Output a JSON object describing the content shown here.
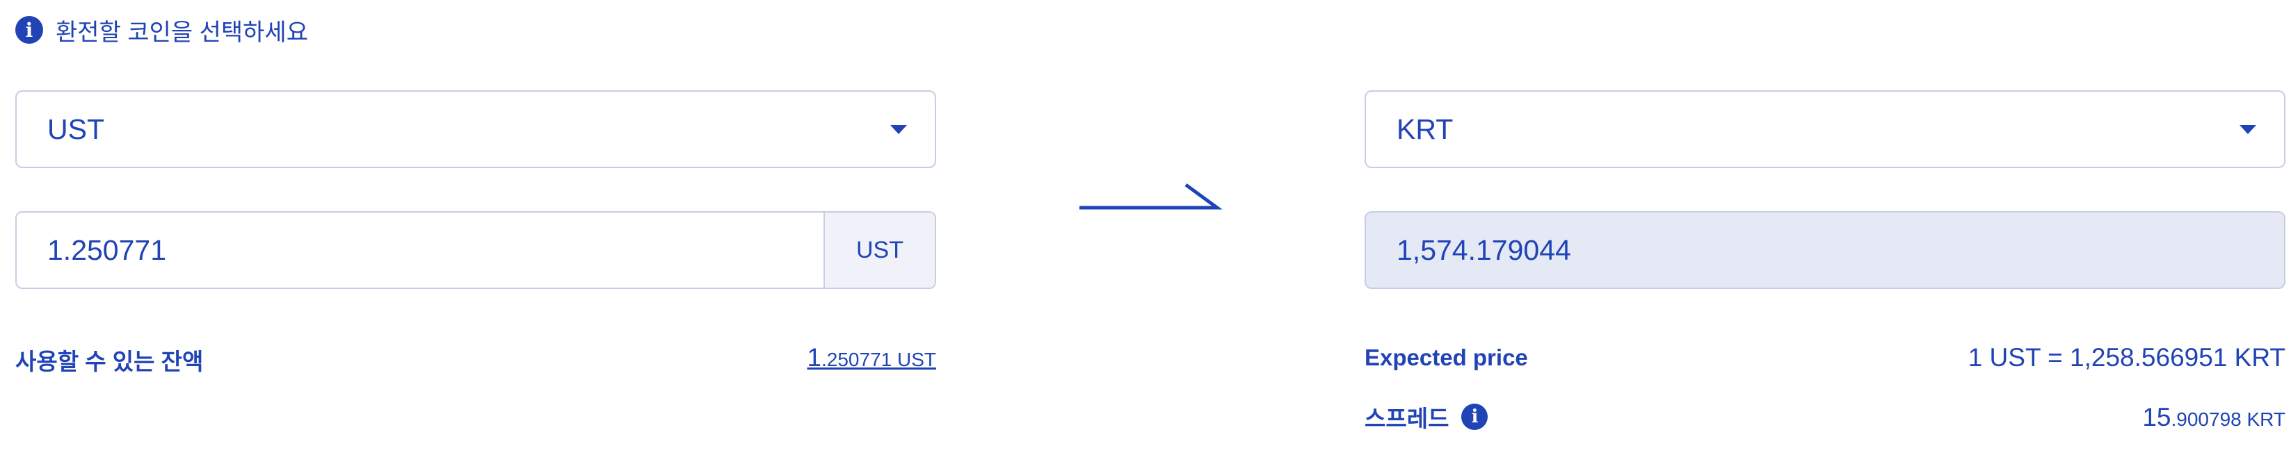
{
  "hint": {
    "text": "환전할 코인을 선택하세요"
  },
  "from": {
    "coin": "UST",
    "amount": "1.250771",
    "unit": "UST"
  },
  "to": {
    "coin": "KRT",
    "amount": "1,574.179044"
  },
  "balance": {
    "label": "사용할 수 있는 잔액",
    "value_int": "1",
    "value_frac": ".250771 UST"
  },
  "expected": {
    "label": "Expected price",
    "value": "1 UST = 1,258.566951 KRT"
  },
  "spread": {
    "label": "스프레드",
    "value_int": "15",
    "value_frac": ".900798 KRT"
  },
  "colors": {
    "accent": "#2043b5",
    "border": "#c8cde6",
    "readonly_bg": "#e5e8f5"
  }
}
